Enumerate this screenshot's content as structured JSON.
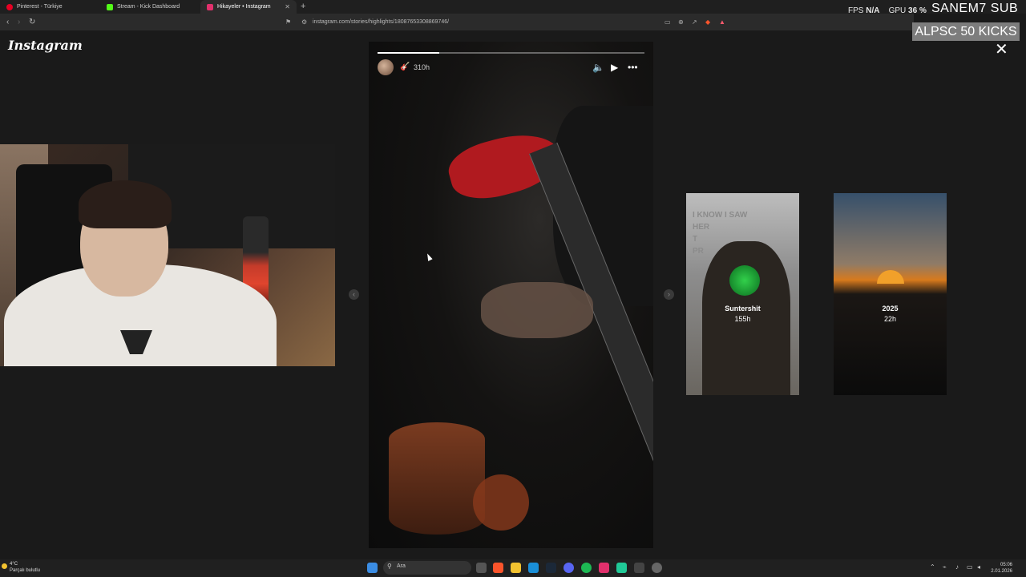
{
  "browser": {
    "tabs": [
      {
        "label": "Pinterest - Türkiye",
        "favicon_color": "#e60023",
        "active": false
      },
      {
        "label": "Stream - Kick Dashboard",
        "favicon_color": "#53fc18",
        "active": false
      },
      {
        "label": "Hikayeler • Instagram",
        "favicon_color": "#e1306c",
        "active": true
      }
    ],
    "new_tab_label": "+",
    "url": "instagram.com/stories/highlights/18087653308869746/"
  },
  "overlay": {
    "fps_label": "FPS",
    "fps_value": "N/A",
    "gpu_label": "GPU",
    "gpu_value": "36 %",
    "streamer_name": "SANEM7 SUB",
    "kicks_banner": "ALPSC  50 KICKS"
  },
  "instagram": {
    "logo": "Instagram",
    "close_symbol": "✕",
    "story": {
      "time": "310h",
      "emoji": "🎸",
      "progress_fraction": 0.23
    },
    "previews": [
      {
        "title": "Suntershit",
        "time": "155h",
        "overlay_text": "I KNOW I SAW\nHER\nT\nPR"
      },
      {
        "title": "2025",
        "time": "22h"
      }
    ]
  },
  "taskbar": {
    "weather_temp": "4°C",
    "weather_text": "Parçalı bulutlu",
    "search_placeholder": "Ara",
    "time": "05:06",
    "date": "2.01.2026"
  },
  "colors": {
    "accent_instagram": "#e1306c",
    "kick_green": "#53fc18",
    "background": "#1a1a1a"
  }
}
